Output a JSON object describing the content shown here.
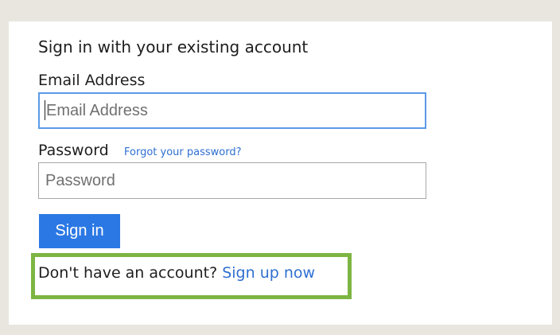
{
  "form": {
    "heading": "Sign in with your existing account",
    "email_label": "Email Address",
    "email_placeholder": "Email Address",
    "email_value": "",
    "password_label": "Password",
    "forgot_link": "Forgot your password?",
    "password_placeholder": "Password",
    "password_value": "",
    "signin_label": "Sign in",
    "signup_prompt": "Don't have an account?",
    "signup_link": "Sign up now"
  },
  "colors": {
    "page_background": "#e8e6df",
    "card_background": "#ffffff",
    "accent_button": "#2b78e4",
    "link": "#2f6fd0",
    "focus_border": "#5b9ae6",
    "highlight_border": "#7db543"
  }
}
